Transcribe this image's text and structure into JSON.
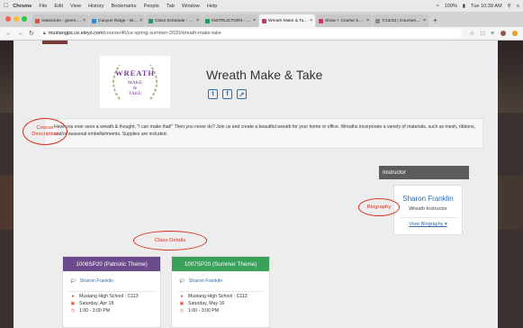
{
  "menubar": {
    "app": "Chrome",
    "menus": [
      "File",
      "Edit",
      "View",
      "History",
      "Bookmarks",
      "People",
      "Tab",
      "Window",
      "Help"
    ],
    "battery": "100%",
    "clock": "Tue 10:39 AM"
  },
  "tabs": [
    {
      "label": "classroom - green…",
      "color": "#e34b3a"
    },
    {
      "label": "Canyon Ridge - Wh…",
      "color": "#2a8bd6"
    },
    {
      "label": "Class Schedule - G…",
      "color": "#1e9b5a"
    },
    {
      "label": "INSTRUCTORS - G…",
      "color": "#1e9b5a"
    },
    {
      "label": "Wreath Make & Tak…",
      "color": "#c03a5c",
      "active": true
    },
    {
      "label": "Show + Course Sect…",
      "color": "#c03a5c"
    },
    {
      "label": "7/13/18 | Courses@…",
      "color": "#888888"
    }
  ],
  "address": {
    "host": "mustangps.ce.eleyo.com",
    "path": "/course/46/ce-spring-summer-2020/wreath-make-take"
  },
  "course": {
    "logo": {
      "line1": "WREATH",
      "line2": "MAKE",
      "line3": "&",
      "line4": "TAKE"
    },
    "title": "Wreath Make & Take",
    "share_icons": [
      "twitter-icon",
      "facebook-icon",
      "share-icon"
    ],
    "description": "Have you ever seen a wreath & thought, \"I can make that!\" Then you never do? Join us and create a beautiful wreath for your home or office. Wreaths incorporate a variety of materials, such as mesh, ribbons, and/or seasonal embellishments. Supplies are included."
  },
  "annotations": {
    "course_description_1": "Course",
    "course_description_2": "Description",
    "biography": "Biography",
    "class_details": "Class Details"
  },
  "instructor": {
    "heading": "Instructor",
    "name": "Sharon Franklin",
    "role": "Wreath Instructor",
    "link": "View Biography"
  },
  "sections": [
    {
      "title": "1006SP20 (Patriotic Theme)",
      "color": "#6a4c8c",
      "instructor": "Sharon Franklin",
      "location": "Mustang High School : C113",
      "date": "Saturday, Apr 18",
      "time": "1:00 - 3:00 PM"
    },
    {
      "title": "1007SP20 (Summer Theme)",
      "color": "#3aa05a",
      "instructor": "Sharon Franklin",
      "location": "Mustang High School : C113",
      "date": "Saturday, May 16",
      "time": "1:00 - 3:00 PM"
    }
  ],
  "colors": {
    "link": "#2d6ca8",
    "annotation": "#d9301e",
    "instructor_header": "#5c5c5c"
  }
}
